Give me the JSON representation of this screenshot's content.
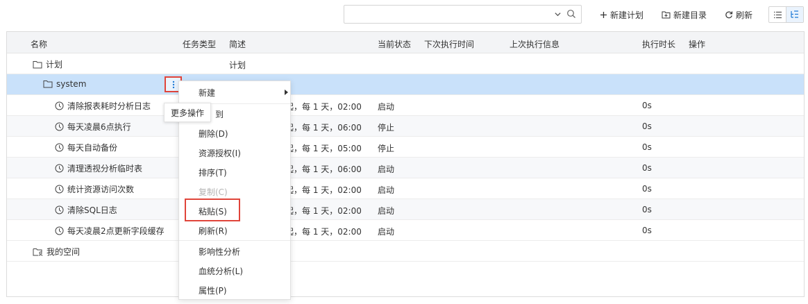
{
  "toolbar": {
    "search": {
      "value": "",
      "placeholder": ""
    },
    "new_plan_label": "新建计划",
    "new_folder_label": "新建目录",
    "refresh_label": "刷新"
  },
  "table": {
    "headers": [
      "名称",
      "任务类型",
      "简述",
      "当前状态",
      "下次执行时间",
      "上次执行信息",
      "执行时长",
      "操作"
    ],
    "rows": [
      {
        "name": "计划",
        "desc": "计划",
        "schedule": "",
        "status": "",
        "duration": ""
      },
      {
        "name": "system",
        "desc": "",
        "schedule": "",
        "status": "",
        "duration": ""
      },
      {
        "name": "清除报表耗时分析日志",
        "desc": "",
        "schedule": "起，每 1 天，02:00",
        "status": "启动",
        "duration": "0s"
      },
      {
        "name": "每天凌晨6点执行",
        "desc": "",
        "schedule": "起，每 1 天，06:00",
        "status": "停止",
        "duration": "0s"
      },
      {
        "name": "每天自动备份",
        "desc": "",
        "schedule": "起，每 1 天，05:00",
        "status": "停止",
        "duration": "0s"
      },
      {
        "name": "清理透视分析临时表",
        "desc": "",
        "schedule": "起，每 1 天，06:00",
        "status": "启动",
        "duration": "0s"
      },
      {
        "name": "统计资源访问次数",
        "desc": "",
        "schedule": "起，每 1 天，02:00",
        "status": "启动",
        "duration": "0s"
      },
      {
        "name": "清除SQL日志",
        "desc": "",
        "schedule": "起，每 1 天，02:00",
        "status": "启动",
        "duration": "0s"
      },
      {
        "name": "每天凌晨2点更新字段缓存",
        "desc": "",
        "schedule": "起，每 1 天，02:00",
        "status": "启动",
        "duration": "0s"
      },
      {
        "name": "我的空间",
        "desc": "",
        "schedule": "",
        "status": "",
        "duration": ""
      }
    ]
  },
  "tooltip": {
    "label": "更多操作"
  },
  "context_menu": {
    "items": [
      "新建",
      "到",
      "删除(D)",
      "资源授权(I)",
      "排序(T)",
      "复制(C)",
      "粘贴(S)",
      "刷新(R)",
      "影响性分析",
      "血统分析(L)",
      "属性(P)"
    ]
  },
  "colors": {
    "selected_row": "#c9e1fa",
    "highlight_border": "#e0443a",
    "header_bg": "#f3f4f6"
  }
}
